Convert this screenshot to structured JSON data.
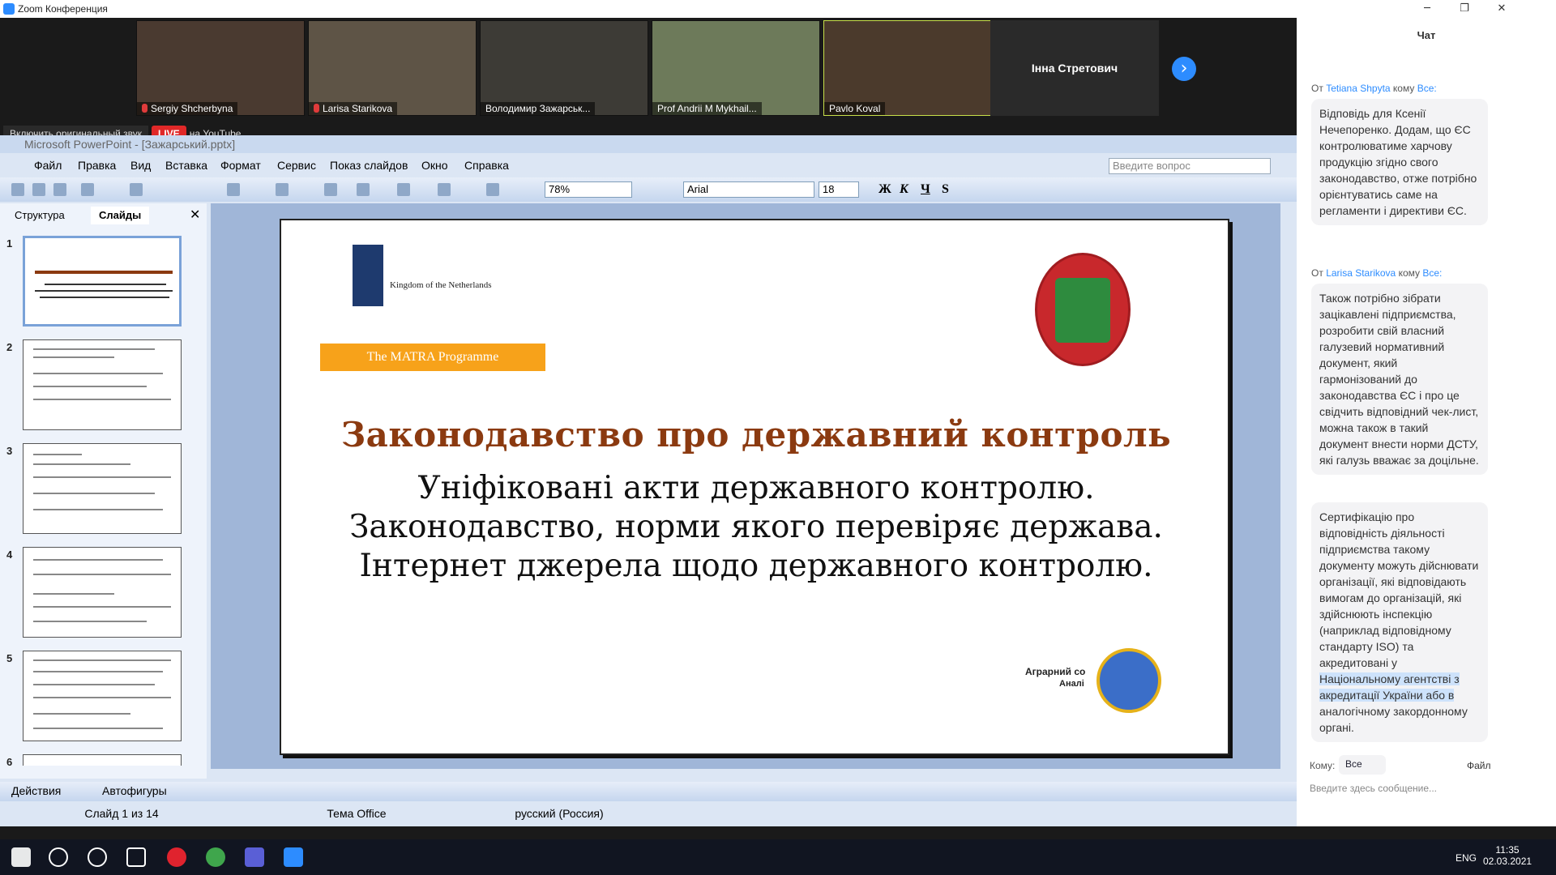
{
  "window": {
    "title": "Zoom Конференция",
    "min": "─",
    "max": "❐",
    "close": "✕"
  },
  "video": {
    "participants": [
      {
        "name": "Sergiy Shcherbyna",
        "muted": true,
        "bg": "#4a3a30"
      },
      {
        "name": "Larisa Starikova",
        "muted": true,
        "bg": "#5e5446"
      },
      {
        "name": "Володимир Зажарськ...",
        "muted": false,
        "bg": "#3d3b36"
      },
      {
        "name": "Prof Andrii M Mykhail...",
        "muted": false,
        "bg": "#6d7a5a"
      },
      {
        "name": "Pavlo Koval",
        "muted": false,
        "bg": "#4b3a2c"
      }
    ],
    "name_only_tile": "Інна Стретович",
    "next": "›"
  },
  "audio": {
    "original": "Включить оригинальный звук",
    "live": "LIVE",
    "youtube": "на YouTube"
  },
  "ppt": {
    "title": "Microsoft PowerPoint - [Зажарський.pptx]",
    "menu": [
      "Файл",
      "Правка",
      "Вид",
      "Вставка",
      "Формат",
      "Сервис",
      "Показ слайдов",
      "Окно",
      "Справка"
    ],
    "help_placeholder": "Введите вопрос",
    "zoom": "78%",
    "font": "Arial",
    "size": "18",
    "format_buttons": [
      "Ж",
      "К",
      "Ч",
      "S"
    ],
    "tabs": [
      "Структура",
      "Слайды"
    ],
    "slide_numbers": [
      "1",
      "2",
      "3",
      "4",
      "5",
      "6"
    ],
    "slide": {
      "kingdom": "Kingdom of the Netherlands",
      "matra": "The MATRA Programme",
      "title": "Законодавство про державний контроль",
      "lines": [
        "Уніфіковані акти державного контролю.",
        "Законодавство, норми якого перевіряє держава.",
        "Інтернет джерела щодо державного контролю."
      ],
      "agri_1": "Аграрний со",
      "agri_2": "Аналі"
    },
    "draw_actions": "Действия",
    "draw_autoshapes": "Автофигуры",
    "status": {
      "slide": "Слайд 1 из 14",
      "theme": "Тема Office",
      "lang": "русский (Россия)"
    }
  },
  "chat": {
    "title": "Чат",
    "messages": [
      {
        "from_prefix": "От",
        "from": "Tetiana Shpyta",
        "to_prefix": "кому",
        "to": "Все:",
        "text": "Відповідь для Ксенії Нечепоренко. Додам, що ЄС контролюватиме харчову продукцію згідно свого законодавство, отже потрібно орієнтуватись саме на регламенти і директиви ЄС."
      },
      {
        "from_prefix": "От",
        "from": "Larisa Starikova",
        "to_prefix": "кому",
        "to": "Все:",
        "text": "Також потрібно зібрати зацікавлені підприємства, розробити свій власний галузевий нормативний документ, який гармонізований до законодавства ЄС і про це свідчить відповідний чек-лист, можна також в такий документ внести норми ДСТУ, які галузь вважає за доцільне."
      }
    ],
    "followup_plain": "Сертифікацію про відповідність діяльності підприємства такому документу можуть дійснювати організації, які відповідають вимогам до організацій, які здійснюють інспекцію (наприклад відповідному стандарту ISO) та акредитовані у ",
    "followup_highlight": "Національному агентстві з акредитації України або в",
    "followup_tail": " аналогічному закордонному органі.",
    "to_label": "Кому:",
    "to_value": "Все",
    "file_label": "Файл",
    "input_placeholder": "Введите здесь сообщение..."
  },
  "taskbar": {
    "lang": "ENG",
    "time": "11:35",
    "date": "02.03.2021"
  }
}
